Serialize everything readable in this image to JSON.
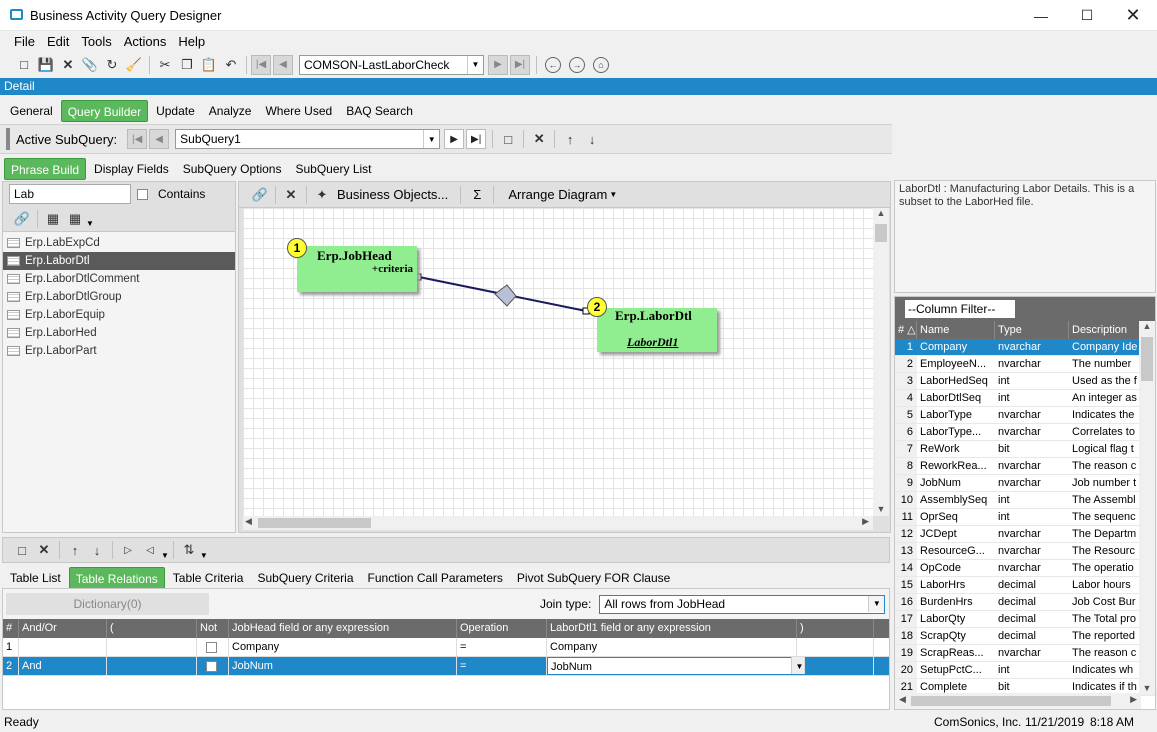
{
  "window": {
    "title": "Business Activity Query Designer"
  },
  "menu": [
    "File",
    "Edit",
    "Tools",
    "Actions",
    "Help"
  ],
  "toolbar": {
    "query_combo": "COMSON-LastLaborCheck"
  },
  "detail_label": "Detail",
  "main_tabs": [
    {
      "label": "General",
      "active": false
    },
    {
      "label": "Query Builder",
      "active": true
    },
    {
      "label": "Update",
      "active": false
    },
    {
      "label": "Analyze",
      "active": false
    },
    {
      "label": "Where Used",
      "active": false
    },
    {
      "label": "BAQ Search",
      "active": false
    }
  ],
  "subquery": {
    "label": "Active SubQuery:",
    "value": "SubQuery1"
  },
  "sub_tabs": [
    {
      "label": "Phrase Build",
      "active": true
    },
    {
      "label": "Display Fields",
      "active": false
    },
    {
      "label": "SubQuery Options",
      "active": false
    },
    {
      "label": "SubQuery List",
      "active": false
    }
  ],
  "search": {
    "value": "Lab",
    "contains_label": "Contains"
  },
  "tables": [
    {
      "name": "Erp.LabExpCd",
      "selected": false
    },
    {
      "name": "Erp.LaborDtl",
      "selected": true
    },
    {
      "name": "Erp.LaborDtlComment",
      "selected": false
    },
    {
      "name": "Erp.LaborDtlGroup",
      "selected": false
    },
    {
      "name": "Erp.LaborEquip",
      "selected": false
    },
    {
      "name": "Erp.LaborHed",
      "selected": false
    },
    {
      "name": "Erp.LaborPart",
      "selected": false
    }
  ],
  "diagram_toolbar": {
    "business_objects": "Business Objects...",
    "sigma": "Σ",
    "arrange": "Arrange Diagram"
  },
  "diagram": {
    "table1": {
      "num": "1",
      "name": "Erp.JobHead",
      "sub": "+criteria"
    },
    "table2": {
      "num": "2",
      "name": "Erp.LaborDtl",
      "alias": "LaborDtl1"
    }
  },
  "description": "LaborDtl : Manufacturing Labor Details. This is a subset to the LaborHed file.",
  "column_filter": "--Column Filter--",
  "columns_header": {
    "num": "#",
    "name": "Name",
    "type": "Type",
    "desc": "Description"
  },
  "columns": [
    {
      "n": "1",
      "name": "Company",
      "type": "nvarchar",
      "desc": "Company Ide"
    },
    {
      "n": "2",
      "name": "EmployeeN...",
      "type": "nvarchar",
      "desc": "The number"
    },
    {
      "n": "3",
      "name": "LaborHedSeq",
      "type": "int",
      "desc": "Used as the f"
    },
    {
      "n": "4",
      "name": "LaborDtlSeq",
      "type": "int",
      "desc": "An integer as"
    },
    {
      "n": "5",
      "name": "LaborType",
      "type": "nvarchar",
      "desc": "Indicates the"
    },
    {
      "n": "6",
      "name": "LaborType...",
      "type": "nvarchar",
      "desc": "Correlates to"
    },
    {
      "n": "7",
      "name": "ReWork",
      "type": "bit",
      "desc": "Logical flag t"
    },
    {
      "n": "8",
      "name": "ReworkRea...",
      "type": "nvarchar",
      "desc": "The reason c"
    },
    {
      "n": "9",
      "name": "JobNum",
      "type": "nvarchar",
      "desc": "Job number t"
    },
    {
      "n": "10",
      "name": "AssemblySeq",
      "type": "int",
      "desc": "The Assembl"
    },
    {
      "n": "11",
      "name": "OprSeq",
      "type": "int",
      "desc": "The sequenc"
    },
    {
      "n": "12",
      "name": "JCDept",
      "type": "nvarchar",
      "desc": "The Departm"
    },
    {
      "n": "13",
      "name": "ResourceG...",
      "type": "nvarchar",
      "desc": "The Resourc"
    },
    {
      "n": "14",
      "name": "OpCode",
      "type": "nvarchar",
      "desc": "The operatio"
    },
    {
      "n": "15",
      "name": "LaborHrs",
      "type": "decimal",
      "desc": "Labor hours"
    },
    {
      "n": "16",
      "name": "BurdenHrs",
      "type": "decimal",
      "desc": "Job Cost Bur"
    },
    {
      "n": "17",
      "name": "LaborQty",
      "type": "decimal",
      "desc": "The Total pro"
    },
    {
      "n": "18",
      "name": "ScrapQty",
      "type": "decimal",
      "desc": "The reported"
    },
    {
      "n": "19",
      "name": "ScrapReas...",
      "type": "nvarchar",
      "desc": "The reason c"
    },
    {
      "n": "20",
      "name": "SetupPctC...",
      "type": "int",
      "desc": "Indicates wh"
    },
    {
      "n": "21",
      "name": "Complete",
      "type": "bit",
      "desc": "Indicates if th"
    }
  ],
  "bottom_tabs": [
    {
      "label": "Table List",
      "active": false
    },
    {
      "label": "Table Relations",
      "active": true
    },
    {
      "label": "Table Criteria",
      "active": false
    },
    {
      "label": "SubQuery Criteria",
      "active": false
    },
    {
      "label": "Function Call Parameters",
      "active": false
    },
    {
      "label": "Pivot SubQuery FOR Clause",
      "active": false
    }
  ],
  "dictionary_btn": "Dictionary(0)",
  "join": {
    "label": "Join type:",
    "value": "All rows from JobHead"
  },
  "relations_header": [
    "#",
    "And/Or",
    "(",
    "Not",
    "JobHead field or any expression",
    "Operation",
    "LaborDtl1 field or any expression",
    ")"
  ],
  "relations": [
    {
      "n": "1",
      "andor": "",
      "paren": "",
      "left": "Company",
      "op": "=",
      "right": "Company",
      "close": ""
    },
    {
      "n": "2",
      "andor": "And",
      "paren": "",
      "left": "JobNum",
      "op": "=",
      "right": "JobNum",
      "close": ""
    }
  ],
  "status": {
    "left": "Ready",
    "company": "ComSonics, Inc.",
    "date": "11/21/2019",
    "time": "8:18 AM"
  }
}
